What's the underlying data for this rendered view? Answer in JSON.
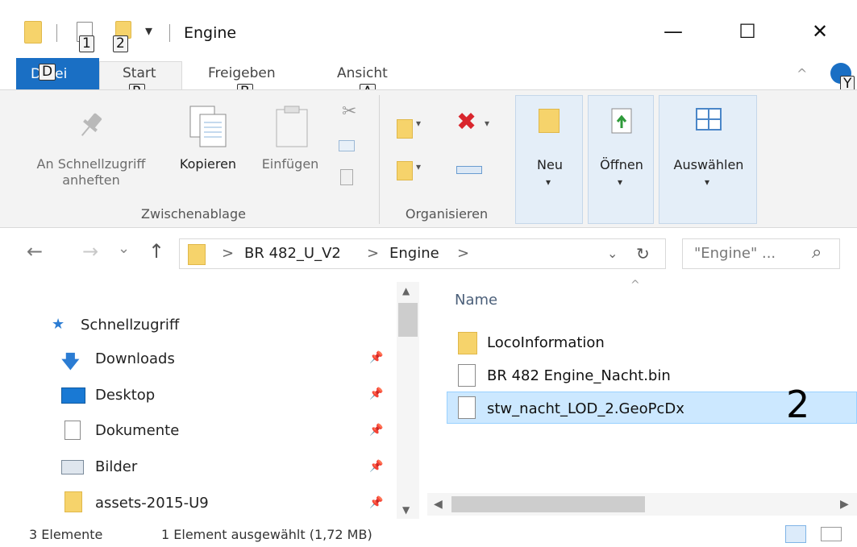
{
  "window": {
    "title": "Engine",
    "minimize_label": "—",
    "maximize_label": "☐",
    "close_label": "✕"
  },
  "quick_access_toolbar": {
    "keytip_1": "1",
    "keytip_2": "2",
    "dropdown_glyph": "▾"
  },
  "ribbon_tabs": {
    "file": "Datei",
    "file_keytip": "D",
    "start": "Start",
    "start_keytip": "R",
    "share": "Freigeben",
    "share_keytip": "B",
    "view": "Ansicht",
    "view_keytip": "A",
    "help_keytip": "Y",
    "collapse_glyph": "^"
  },
  "ribbon": {
    "pin_label": "An Schnellzugriff anheften",
    "copy_label": "Kopieren",
    "paste_label": "Einfügen",
    "clipboard_group": "Zwischenablage",
    "organize_group": "Organisieren",
    "new_label": "Neu",
    "open_label": "Öffnen",
    "select_label": "Auswählen",
    "delete_glyph": "✖",
    "dropdown_glyph": "▾"
  },
  "address_bar": {
    "crumbs": [
      "BR 482_U_V2",
      "Engine"
    ],
    "separator": ">",
    "search_placeholder": "\"Engine\" ...",
    "back_glyph": "←",
    "forward_glyph": "→",
    "recent_glyph": "⌄",
    "up_glyph": "↑",
    "refresh_glyph": "↻",
    "history_glyph": "⌄",
    "search_glyph": "⌕"
  },
  "nav_pane": {
    "quick_access": "Schnellzugriff",
    "items": [
      "Downloads",
      "Desktop",
      "Dokumente",
      "Bilder",
      "assets-2015-U9"
    ]
  },
  "file_list": {
    "column_name": "Name",
    "sort_glyph": "^",
    "items": [
      {
        "name": "LocoInformation",
        "type": "folder"
      },
      {
        "name": "BR 482 Engine_Nacht.bin",
        "type": "file"
      },
      {
        "name": "stw_nacht_LOD_2.GeoPcDx",
        "type": "file"
      }
    ],
    "annotation": "2"
  },
  "status_bar": {
    "count": "3 Elemente",
    "selection": "1 Element ausgewählt (1,72 MB)"
  },
  "colors": {
    "accent": "#1a6fc4",
    "folder": "#f6d36b",
    "selection": "#cce8ff"
  }
}
